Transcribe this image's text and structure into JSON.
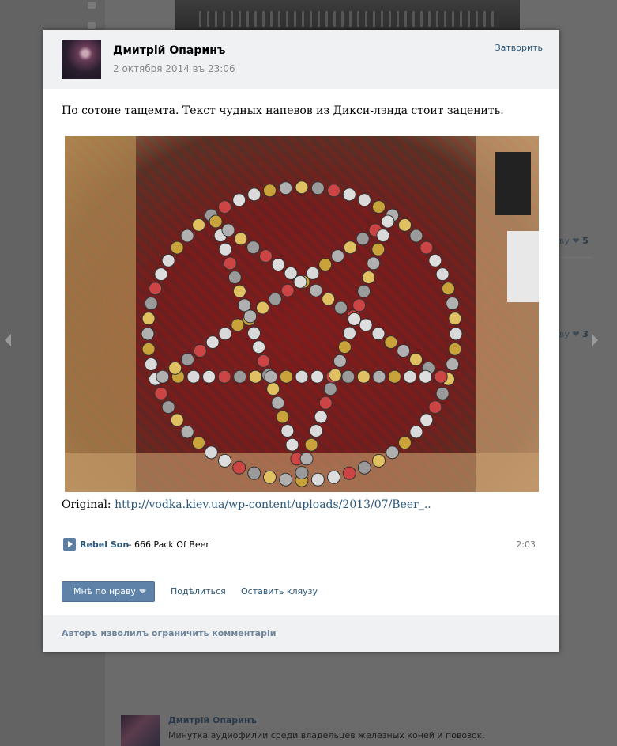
{
  "background": {
    "likes_row_1": {
      "label": "ву",
      "count": "5"
    },
    "likes_row_2": {
      "label": "ву",
      "count": "3"
    },
    "post": {
      "author": "Дмитрій Опаринъ",
      "text": "Минутка аудиофилии среди владельцев железных коней и повозок."
    }
  },
  "modal": {
    "author_name": "Дмитрій Опаринъ",
    "date": "2 октября 2014 въ 23:06",
    "close_label": "Затворить",
    "text": "По сотоне тащемта. Текст чудных напевов из Дикси-лэнда стоит заценить.",
    "original_label": "Original:",
    "original_link": "http://vodka.kiev.ua/wp-content/uploads/2013/07/Beer_..",
    "audio": {
      "artist": "Rebel Son",
      "separator": " – ",
      "title": "666 Pack Of Beer",
      "duration": "2:03"
    },
    "like_label": "Мнѣ по нраву",
    "share_label": "Подѣлиться",
    "complain_label": "Оставить кляузу",
    "footer_note": "Авторъ изволилъ ограничить комментаріи"
  },
  "colors": {
    "accent_link": "#2b587a",
    "button_bg": "#5e82a8",
    "header_bg": "#f0f1f3",
    "overlay": "#5d5d5d"
  }
}
